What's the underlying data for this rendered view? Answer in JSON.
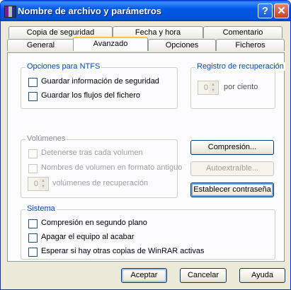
{
  "window": {
    "title": "Nombre de archivo y parámetros",
    "help_label": "?",
    "close_label": "✕"
  },
  "tabs_back": [
    "Copia de seguridad",
    "Fecha y hora",
    "Comentario"
  ],
  "tabs_front": [
    "General",
    "Avanzado",
    "Opciones",
    "Ficheros"
  ],
  "active_tab": "Avanzado",
  "ntfs": {
    "title": "Opciones para NTFS",
    "security": "Guardar información de seguridad",
    "streams": "Guardar los flujos del fichero"
  },
  "recovery": {
    "title": "Registro de recuperación",
    "value": "0",
    "unit": "por ciento"
  },
  "volumes": {
    "title": "Volúmenes",
    "pause": "Detenerse tras cada volumen",
    "old_names": "Nombres de volumen en formato antiguo",
    "rec_value": "0",
    "rec_label": "volúmenes de recuperación"
  },
  "buttons": {
    "compression": "Compresión...",
    "sfx": "Autoextraíble...",
    "password": "Establecer contraseña"
  },
  "system": {
    "title": "Sistema",
    "background": "Compresión en segundo plano",
    "shutdown": "Apagar el equipo al acabar",
    "wait": "Esperar si hay otras copias de WinRAR activas"
  },
  "footer": {
    "ok": "Aceptar",
    "cancel": "Cancelar",
    "help": "Ayuda"
  },
  "icons": {
    "app": "winrar-icon",
    "help": "help-icon",
    "close": "close-icon"
  },
  "colors": {
    "titlebar": "#0058e6",
    "group_title": "#0046d5",
    "active_tab_accent": "#ffc83c"
  }
}
